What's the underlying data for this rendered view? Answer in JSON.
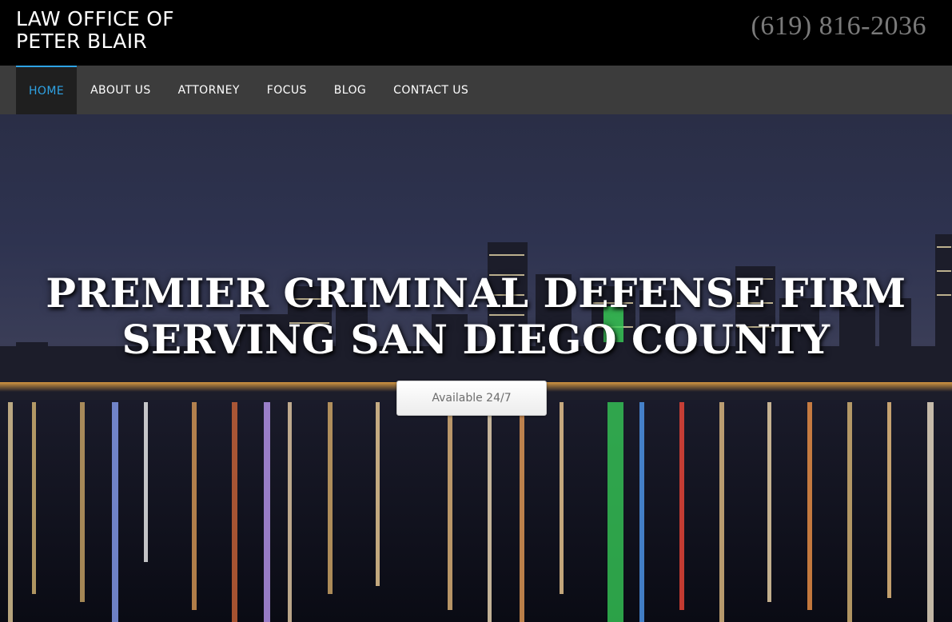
{
  "header": {
    "brand_line1": "LAW OFFICE OF",
    "brand_line2": "PETER BLAIR",
    "phone": "(619) 816-2036"
  },
  "nav": {
    "items": [
      {
        "label": "HOME",
        "active": true
      },
      {
        "label": "ABOUT US"
      },
      {
        "label": "ATTORNEY"
      },
      {
        "label": "FOCUS"
      },
      {
        "label": "BLOG"
      },
      {
        "label": "CONTACT US"
      }
    ]
  },
  "hero": {
    "headline_line1": "PREMIER CRIMINAL DEFENSE FIRM",
    "headline_line2": "SERVING SAN DIEGO COUNTY",
    "cta_label": "Available 24/7"
  },
  "colors": {
    "accent": "#2fa3e4",
    "nav_bg": "#3c3c3c",
    "header_bg": "#000000",
    "phone": "#7a7a7a"
  }
}
